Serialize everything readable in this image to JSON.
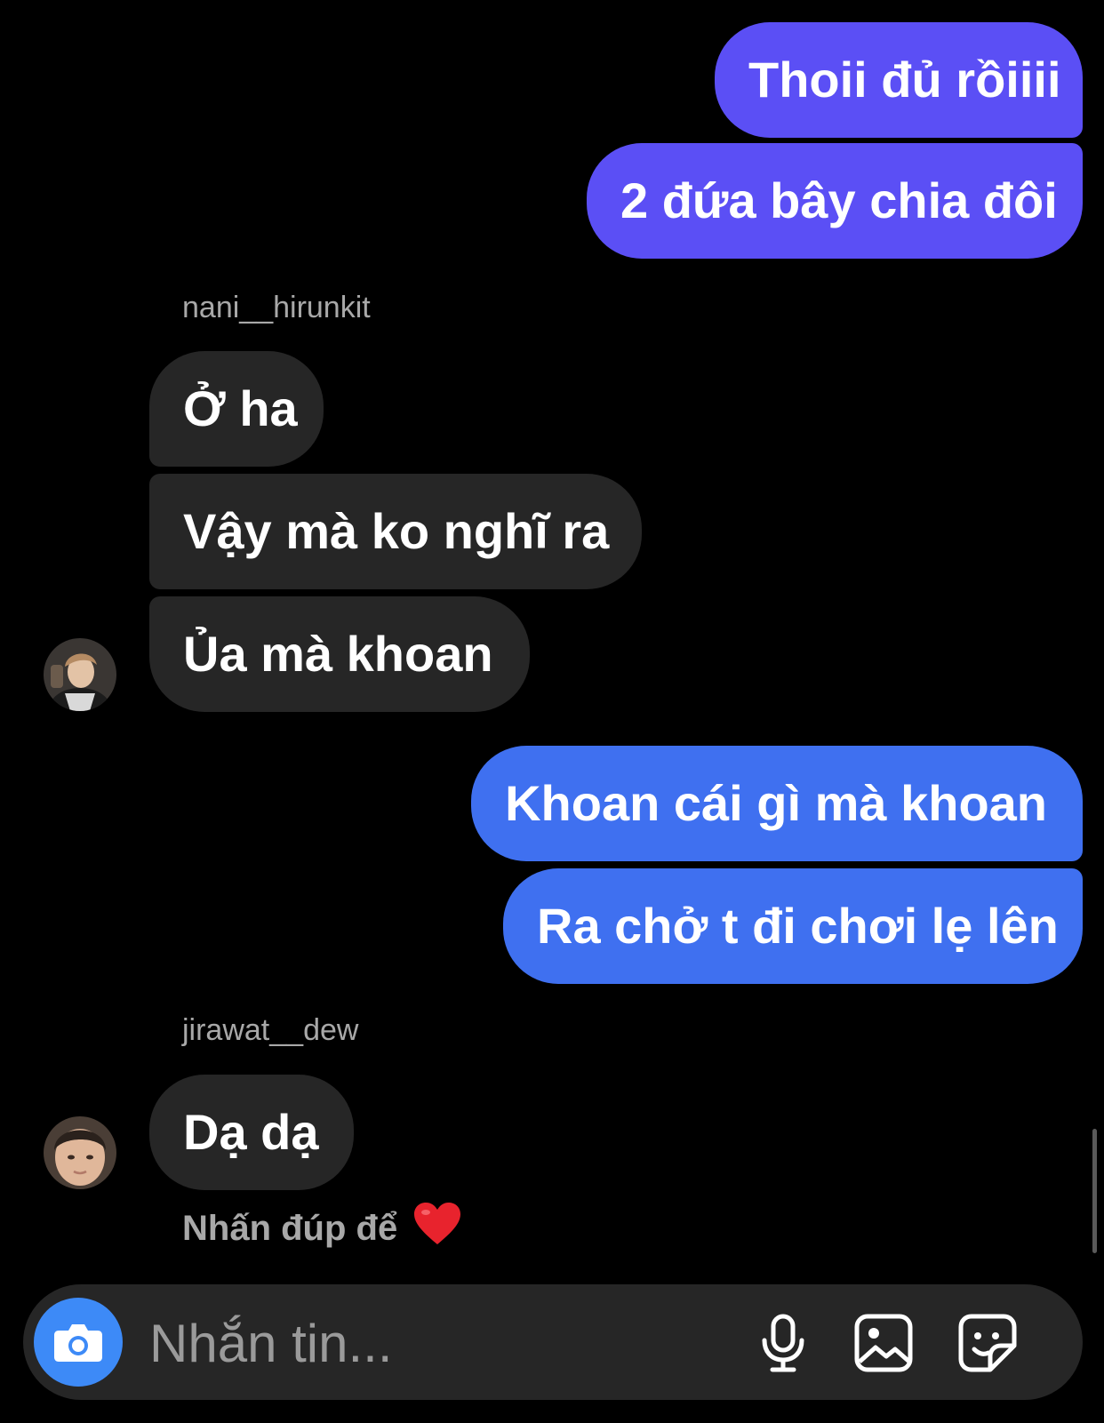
{
  "colors": {
    "background": "#000000",
    "sent_purple": "#5b4ff5",
    "sent_blue": "#3f70f0",
    "received": "#262626",
    "muted_text": "#a8a8a8",
    "camera_accent": "#3d8af7"
  },
  "messages": [
    {
      "from": "me",
      "text": "Thoii đủ rồiiii"
    },
    {
      "from": "me",
      "text": "2 đứa bây chia đôi"
    },
    {
      "from": "nani__hirunkit",
      "text": "Ở ha"
    },
    {
      "from": "nani__hirunkit",
      "text": "Vậy mà ko nghĩ ra"
    },
    {
      "from": "nani__hirunkit",
      "text": "Ủa mà khoan"
    },
    {
      "from": "me",
      "text": "Khoan cái gì mà khoan"
    },
    {
      "from": "me",
      "text": "Ra chở t đi chơi lẹ lên"
    },
    {
      "from": "jirawat__dew",
      "text": "Dạ dạ"
    }
  ],
  "senders": {
    "first": "nani__hirunkit",
    "second": "jirawat__dew"
  },
  "hint": {
    "text": "Nhấn đúp để",
    "icon": "heart-emoji"
  },
  "composer": {
    "placeholder": "Nhắn tin...",
    "icons": [
      "camera-icon",
      "microphone-icon",
      "gallery-icon",
      "sticker-icon"
    ]
  }
}
